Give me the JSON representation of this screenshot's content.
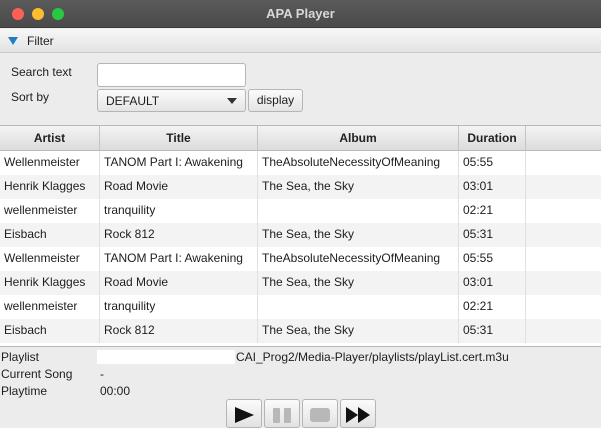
{
  "window": {
    "title": "APA Player"
  },
  "filter": {
    "label": "Filter",
    "search_label": "Search text",
    "search_value": "",
    "sort_label": "Sort by",
    "sort_value": "DEFAULT",
    "display_label": "display"
  },
  "table": {
    "columns": [
      "Artist",
      "Title",
      "Album",
      "Duration",
      ""
    ],
    "rows": [
      [
        "Wellenmeister",
        "TANOM Part I: Awakening",
        "TheAbsoluteNecessityOfMeaning",
        "05:55"
      ],
      [
        "Henrik Klagges",
        "Road Movie",
        "The Sea, the Sky",
        "03:01"
      ],
      [
        "wellenmeister",
        "tranquility",
        "",
        "02:21"
      ],
      [
        "Eisbach",
        "Rock 812",
        "The Sea, the Sky",
        "05:31"
      ],
      [
        "Wellenmeister",
        "TANOM Part I: Awakening",
        "TheAbsoluteNecessityOfMeaning",
        "05:55"
      ],
      [
        "Henrik Klagges",
        "Road Movie",
        "The Sea, the Sky",
        "03:01"
      ],
      [
        "wellenmeister",
        "tranquility",
        "",
        "02:21"
      ],
      [
        "Eisbach",
        "Rock 812",
        "The Sea, the Sky",
        "05:31"
      ]
    ]
  },
  "status": {
    "playlist_label": "Playlist",
    "playlist_value": "CAI_Prog2/Media-Player/playlists/playList.cert.m3u",
    "current_song_label": "Current Song",
    "current_song_value": "-",
    "playtime_label": "Playtime",
    "playtime_value": "00:00"
  },
  "controls": {
    "icons": [
      "play-icon",
      "pause-icon",
      "stop-icon",
      "skip-icon"
    ]
  }
}
